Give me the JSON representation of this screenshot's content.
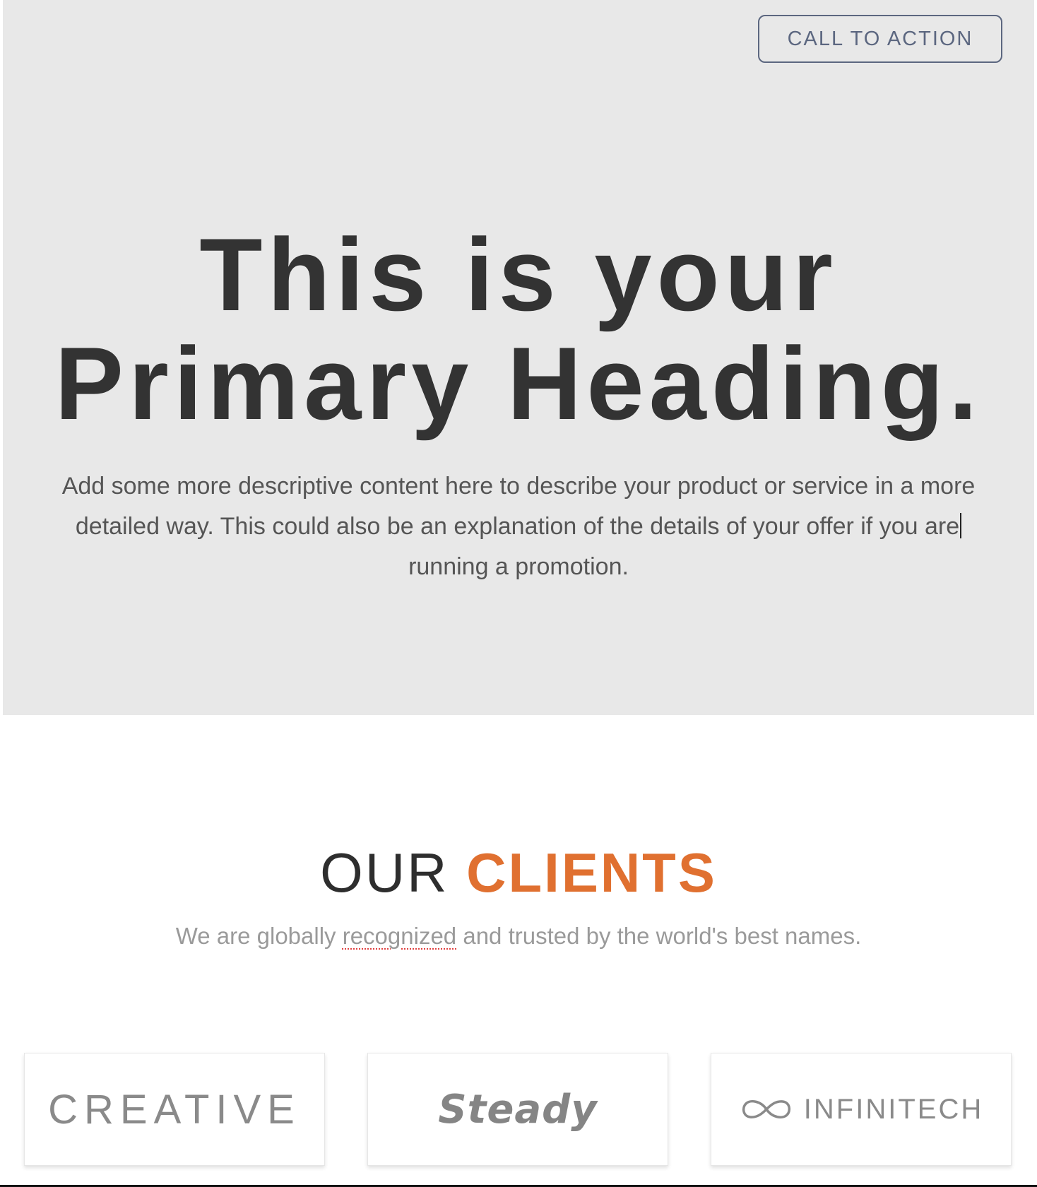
{
  "hero": {
    "cta_label": "CALL TO ACTION",
    "heading_line1": "This is your",
    "heading_line2": "Primary Heading.",
    "body_line1": "Add some more descriptive content here to describe your product or service in a more",
    "body_line2": "detailed way. This could also be an explanation of the details of your offer if you are",
    "body_line3": "running a promotion."
  },
  "clients": {
    "title_plain": "OUR",
    "title_accent": "CLIENTS",
    "subtitle_before": "We are globally ",
    "subtitle_flagged_word": "recognized",
    "subtitle_after": " and trusted by the world's best names.",
    "logos": [
      {
        "name": "CREATIVE"
      },
      {
        "name": "Steady"
      },
      {
        "name": "INFINITECH",
        "icon": "infinity-icon"
      }
    ]
  },
  "colors": {
    "hero_background": "#e8e8e8",
    "heading": "#333333",
    "accent": "#e07030",
    "button_border": "#5c6780",
    "logo_gray": "#8a8a8a",
    "spellcheck_underline": "#e04040"
  }
}
